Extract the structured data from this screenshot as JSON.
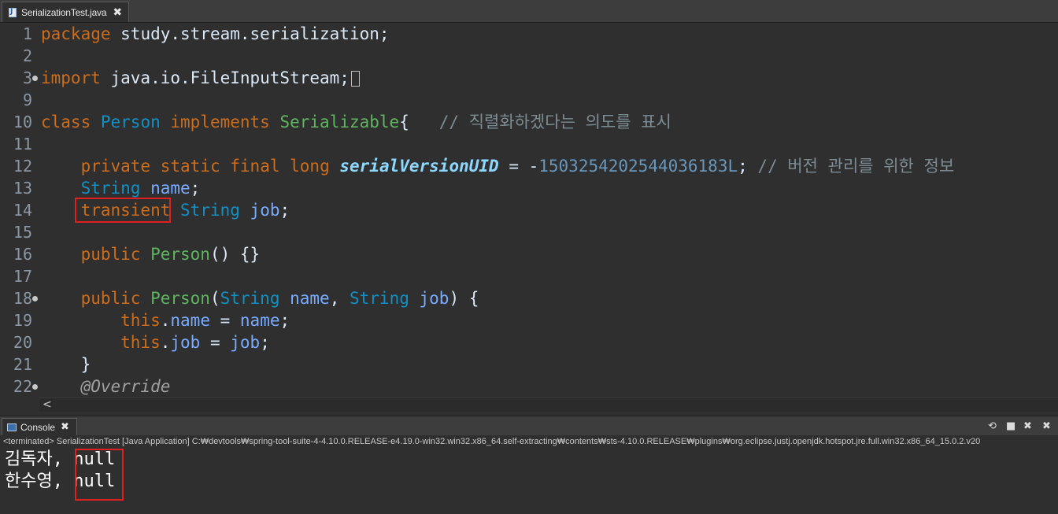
{
  "editor_tab": {
    "label": "SerializationTest.java",
    "close": "✖"
  },
  "lines": [
    {
      "n": "1",
      "code": [
        {
          "c": "kw",
          "t": "package"
        },
        {
          "c": "plain",
          "t": " study.stream.serialization;"
        }
      ]
    },
    {
      "n": "2",
      "code": []
    },
    {
      "n": "3",
      "fold": true,
      "code": [
        {
          "c": "kw",
          "t": "import"
        },
        {
          "c": "plain",
          "t": " java.io.FileInputStream;"
        }
      ],
      "folded": true
    },
    {
      "n": "9",
      "code": []
    },
    {
      "n": "10",
      "code": [
        {
          "c": "kw",
          "t": "class"
        },
        {
          "c": "plain",
          "t": " "
        },
        {
          "c": "ty",
          "t": "Person"
        },
        {
          "c": "plain",
          "t": " "
        },
        {
          "c": "kw",
          "t": "implements"
        },
        {
          "c": "plain",
          "t": " "
        },
        {
          "c": "fn",
          "t": "Serializable"
        },
        {
          "c": "plain",
          "t": "{   "
        },
        {
          "c": "cm",
          "t": "// 직렬화하겠다는 의도를 표시"
        }
      ]
    },
    {
      "n": "11",
      "code": []
    },
    {
      "n": "12",
      "code": [
        {
          "c": "plain",
          "t": "    "
        },
        {
          "c": "kw",
          "t": "private"
        },
        {
          "c": "plain",
          "t": " "
        },
        {
          "c": "kw",
          "t": "static"
        },
        {
          "c": "plain",
          "t": " "
        },
        {
          "c": "kw",
          "t": "final"
        },
        {
          "c": "plain",
          "t": " "
        },
        {
          "c": "kw",
          "t": "long"
        },
        {
          "c": "plain",
          "t": " "
        },
        {
          "c": "sf",
          "t": "serialVersionUID"
        },
        {
          "c": "plain",
          "t": " = -"
        },
        {
          "c": "num",
          "t": "1503254202544036183L"
        },
        {
          "c": "plain",
          "t": "; "
        },
        {
          "c": "cm",
          "t": "// 버전 관리를 위한 정보"
        }
      ]
    },
    {
      "n": "13",
      "code": [
        {
          "c": "plain",
          "t": "    "
        },
        {
          "c": "ty",
          "t": "String"
        },
        {
          "c": "plain",
          "t": " "
        },
        {
          "c": "vr",
          "t": "name"
        },
        {
          "c": "plain",
          "t": ";"
        }
      ]
    },
    {
      "n": "14",
      "code": [
        {
          "c": "plain",
          "t": "    "
        },
        {
          "c": "kw",
          "t": "transient"
        },
        {
          "c": "plain",
          "t": " "
        },
        {
          "c": "ty",
          "t": "String"
        },
        {
          "c": "plain",
          "t": " "
        },
        {
          "c": "vr",
          "t": "job"
        },
        {
          "c": "plain",
          "t": ";"
        }
      ]
    },
    {
      "n": "15",
      "code": []
    },
    {
      "n": "16",
      "code": [
        {
          "c": "plain",
          "t": "    "
        },
        {
          "c": "kw",
          "t": "public"
        },
        {
          "c": "plain",
          "t": " "
        },
        {
          "c": "fn",
          "t": "Person"
        },
        {
          "c": "plain",
          "t": "() {}"
        }
      ]
    },
    {
      "n": "17",
      "code": []
    },
    {
      "n": "18",
      "fold": true,
      "code": [
        {
          "c": "plain",
          "t": "    "
        },
        {
          "c": "kw",
          "t": "public"
        },
        {
          "c": "plain",
          "t": " "
        },
        {
          "c": "fn",
          "t": "Person"
        },
        {
          "c": "plain",
          "t": "("
        },
        {
          "c": "ty",
          "t": "String"
        },
        {
          "c": "plain",
          "t": " "
        },
        {
          "c": "vr",
          "t": "name"
        },
        {
          "c": "plain",
          "t": ", "
        },
        {
          "c": "ty",
          "t": "String"
        },
        {
          "c": "plain",
          "t": " "
        },
        {
          "c": "vr",
          "t": "job"
        },
        {
          "c": "plain",
          "t": ") {"
        }
      ]
    },
    {
      "n": "19",
      "code": [
        {
          "c": "plain",
          "t": "        "
        },
        {
          "c": "kw",
          "t": "this"
        },
        {
          "c": "plain",
          "t": "."
        },
        {
          "c": "vr",
          "t": "name"
        },
        {
          "c": "plain",
          "t": " = "
        },
        {
          "c": "vr",
          "t": "name"
        },
        {
          "c": "plain",
          "t": ";"
        }
      ]
    },
    {
      "n": "20",
      "code": [
        {
          "c": "plain",
          "t": "        "
        },
        {
          "c": "kw",
          "t": "this"
        },
        {
          "c": "plain",
          "t": "."
        },
        {
          "c": "vr",
          "t": "job"
        },
        {
          "c": "plain",
          "t": " = "
        },
        {
          "c": "vr",
          "t": "job"
        },
        {
          "c": "plain",
          "t": ";"
        }
      ]
    },
    {
      "n": "21",
      "code": [
        {
          "c": "plain",
          "t": "    }"
        }
      ]
    },
    {
      "n": "22",
      "fold": true,
      "code": [
        {
          "c": "plain",
          "t": "    "
        },
        {
          "c": "an",
          "t": "@Override"
        }
      ]
    }
  ],
  "scroll": {
    "left_arrow": "<"
  },
  "console": {
    "tab_label": "Console",
    "close": "✖",
    "terminated": "<terminated> SerializationTest [Java Application] C:₩devtools₩spring-tool-suite-4-4.10.0.RELEASE-e4.19.0-win32.win32.x86_64.self-extracting₩contents₩sts-4.10.0.RELEASE₩plugins₩org.eclipse.justj.openjdk.hotspot.jre.full.win32.x86_64_15.0.2.v20",
    "output": [
      {
        "name": "김독자, ",
        "value": "null"
      },
      {
        "name": "한수영, ",
        "value": "null"
      }
    ],
    "tools": {
      "relaunch": "⟲",
      "terminate": "■",
      "remove": "✖",
      "remove_all": "✖"
    }
  },
  "colors": {
    "highlight": "#e0201f"
  }
}
